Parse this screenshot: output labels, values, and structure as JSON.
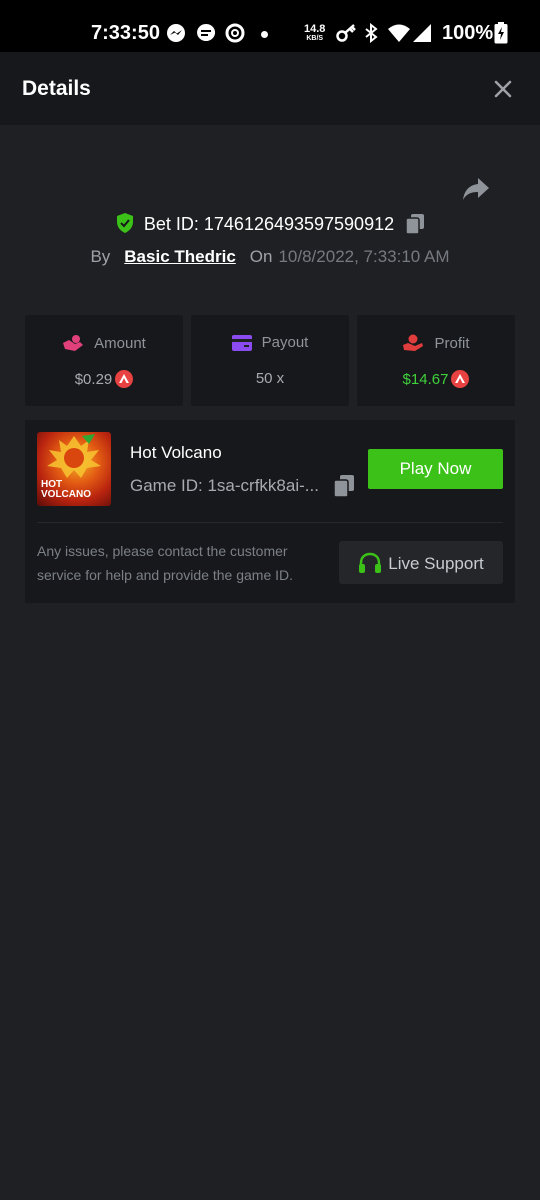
{
  "status_bar": {
    "time": "7:33:50",
    "net_speed": "14.8",
    "net_unit": "KB/S",
    "battery": "100%",
    "icons": [
      "messenger-icon",
      "chat-icon",
      "app-icon",
      "dot-icon",
      "key-icon",
      "bluetooth-icon",
      "wifi-icon",
      "signal-icon",
      "battery-icon"
    ]
  },
  "header": {
    "title": "Details",
    "close_icon": "close-icon"
  },
  "bet": {
    "id_label": "Bet ID: 1746126493597590912",
    "by_label": "By",
    "user": "Basic Thedric",
    "on_label": "On",
    "date": "10/8/2022, 7:33:10 AM"
  },
  "stats": [
    {
      "label": "Amount",
      "value": "$0.29",
      "icon": "money-hand-icon",
      "color": "#e0417a"
    },
    {
      "label": "Payout",
      "value": "50 x",
      "icon": "card-icon",
      "color": "#8a4cf0"
    },
    {
      "label": "Profit",
      "value": "$14.67",
      "icon": "hand-coin-icon",
      "color": "#e23d3d"
    }
  ],
  "game": {
    "thumb_line1": "HOT",
    "thumb_line2": "VOLCANO",
    "name": "Hot Volcano",
    "id_label": "Game ID: 1sa-crfkk8ai-...",
    "play_label": "Play Now",
    "hint": "Any issues, please contact the customer service for help and provide the game ID.",
    "support_label": "Live Support"
  },
  "colors": {
    "accent_green": "#3bc117",
    "profit_green": "#3fd13c",
    "coin_red": "#e84142"
  }
}
